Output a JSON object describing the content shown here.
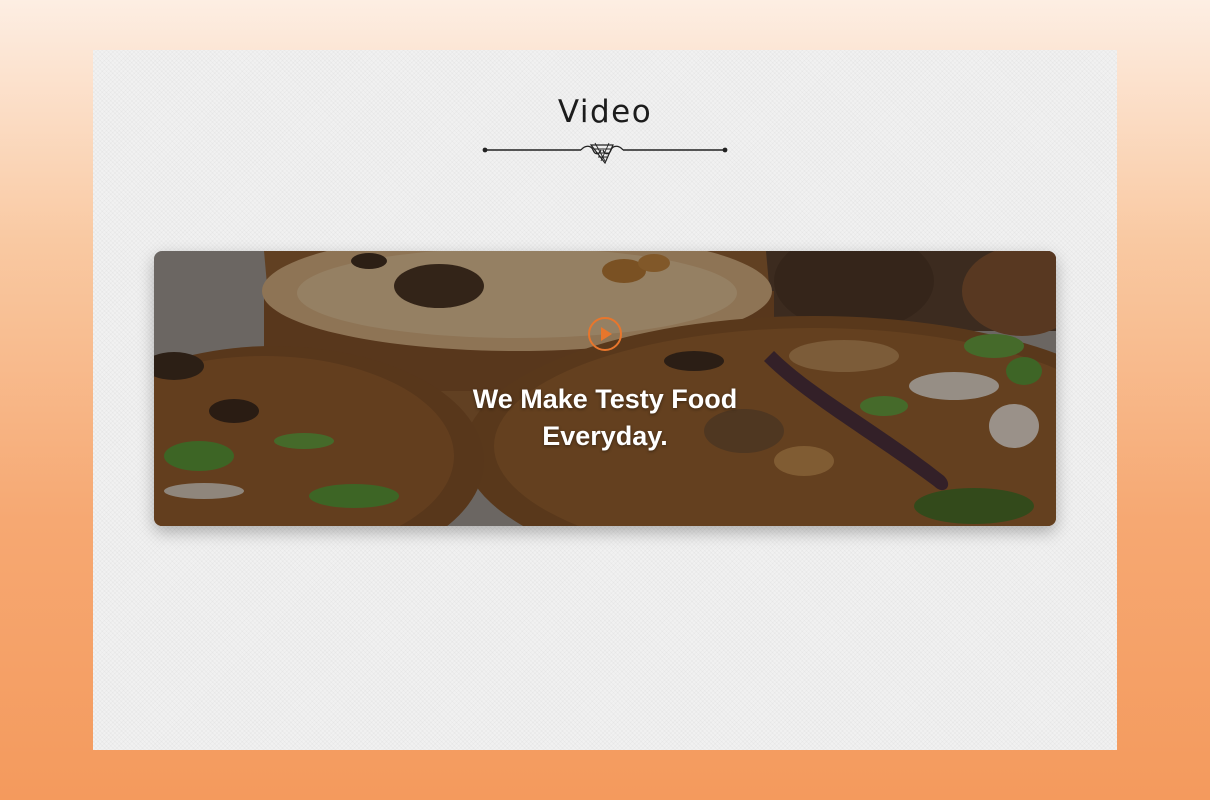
{
  "section": {
    "title": "Video"
  },
  "video": {
    "heading": "We Make Testy Food\nEveryday.",
    "play_icon": "play-icon"
  },
  "colors": {
    "accent": "#e8762c",
    "panel": "#f1f1f1",
    "heading_text": "#ffffff"
  }
}
